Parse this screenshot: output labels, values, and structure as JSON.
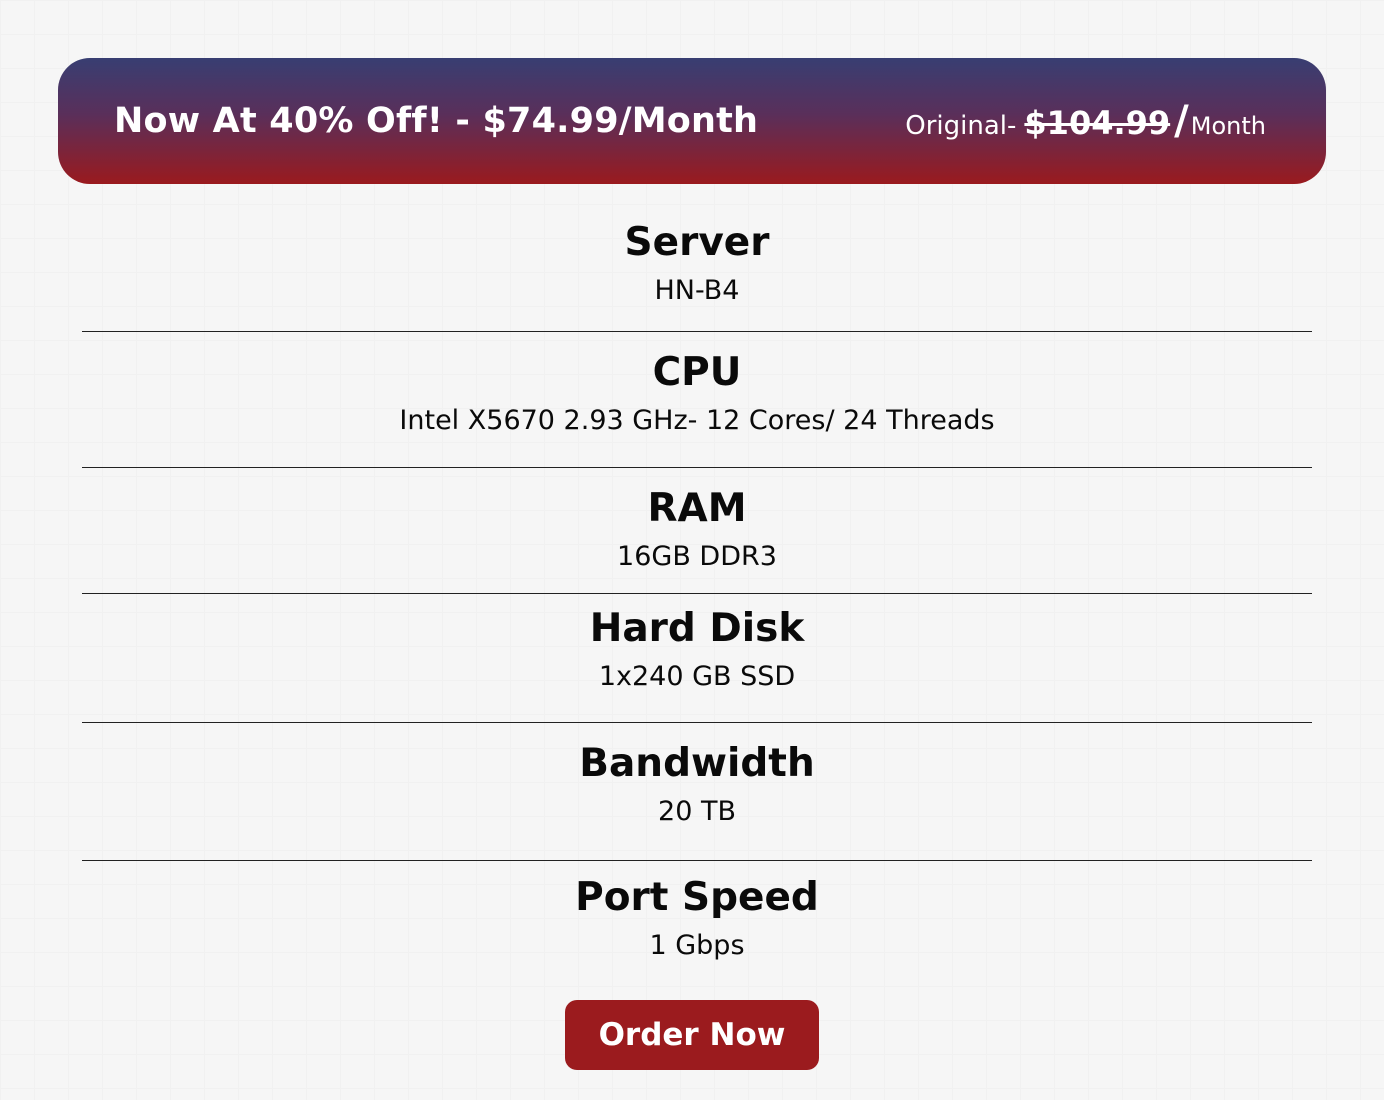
{
  "banner": {
    "promo_text": "Now At 40% Off! - $74.99/Month",
    "original_label": "Original-",
    "original_price": "$104.99",
    "original_slash": "/",
    "original_unit": "Month",
    "gradient_top_color": "#383e72",
    "gradient_bottom_color": "#9a1a1e"
  },
  "specs": [
    {
      "label": "Server",
      "value": "HN-B4"
    },
    {
      "label": "CPU",
      "value": "Intel X5670 2.93 GHz- 12 Cores/ 24 Threads"
    },
    {
      "label": "RAM",
      "value": "16GB DDR3"
    },
    {
      "label": "Hard Disk",
      "value": "1x240 GB SSD"
    },
    {
      "label": "Bandwidth",
      "value": "20 TB"
    },
    {
      "label": "Port Speed",
      "value": "1 Gbps"
    }
  ],
  "order_button": {
    "label": "Order Now",
    "color": "#9b1b1e"
  }
}
